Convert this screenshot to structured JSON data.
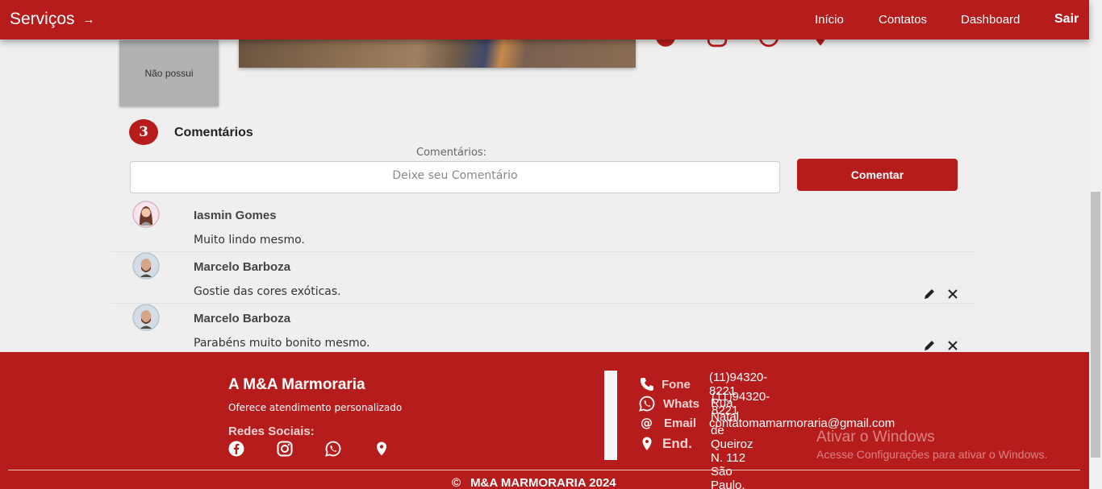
{
  "navbar": {
    "brand": "Serviços",
    "brand_icon": "arrow-right-icon",
    "links": [
      "Início",
      "Contatos",
      "Dashboard"
    ],
    "logout": "Sair"
  },
  "product": {
    "thumbnail_text": "Não possui",
    "share_icons": [
      "facebook-icon",
      "instagram-icon",
      "whatsapp-icon",
      "location-icon"
    ]
  },
  "comments": {
    "count": "3",
    "title": "Comentários",
    "form_label": "Comentários:",
    "input_placeholder": "Deixe seu Comentário",
    "submit_label": "Comentar",
    "items": [
      {
        "author": "Iasmin Gomes",
        "text": "Muito lindo mesmo.",
        "editable": false
      },
      {
        "author": "Marcelo Barboza",
        "text": "Gostie das cores exóticas.",
        "editable": true
      },
      {
        "author": "Marcelo Barboza",
        "text": "Parabéns muito bonito mesmo.",
        "editable": true
      }
    ]
  },
  "footer": {
    "company": "A M&A Marmoraria",
    "tagline": "Oferece atendimento personalizado",
    "social_title": "Redes Sociais:",
    "contacts": [
      {
        "icon": "phone-icon",
        "label": "Fone",
        "value": "(11)94320-8221"
      },
      {
        "icon": "whatsapp-icon",
        "label": "Whats",
        "value": "(11)94320-8221"
      },
      {
        "icon": "at-icon",
        "label": "Email",
        "value": "contatomamarmoraria@gmail.com"
      },
      {
        "icon": "location-icon",
        "label": "End.",
        "value": "Rua Natal de Queiroz N. 112 São Paulo."
      }
    ],
    "copyright_symbol": "©",
    "copyright": "M&A MARMORARIA 2024"
  },
  "watermark": {
    "title": "Ativar o Windows",
    "subtitle": "Acesse Configurações para ativar o Windows."
  },
  "colors": {
    "primary": "#b71c1c",
    "background": "#efefef"
  }
}
